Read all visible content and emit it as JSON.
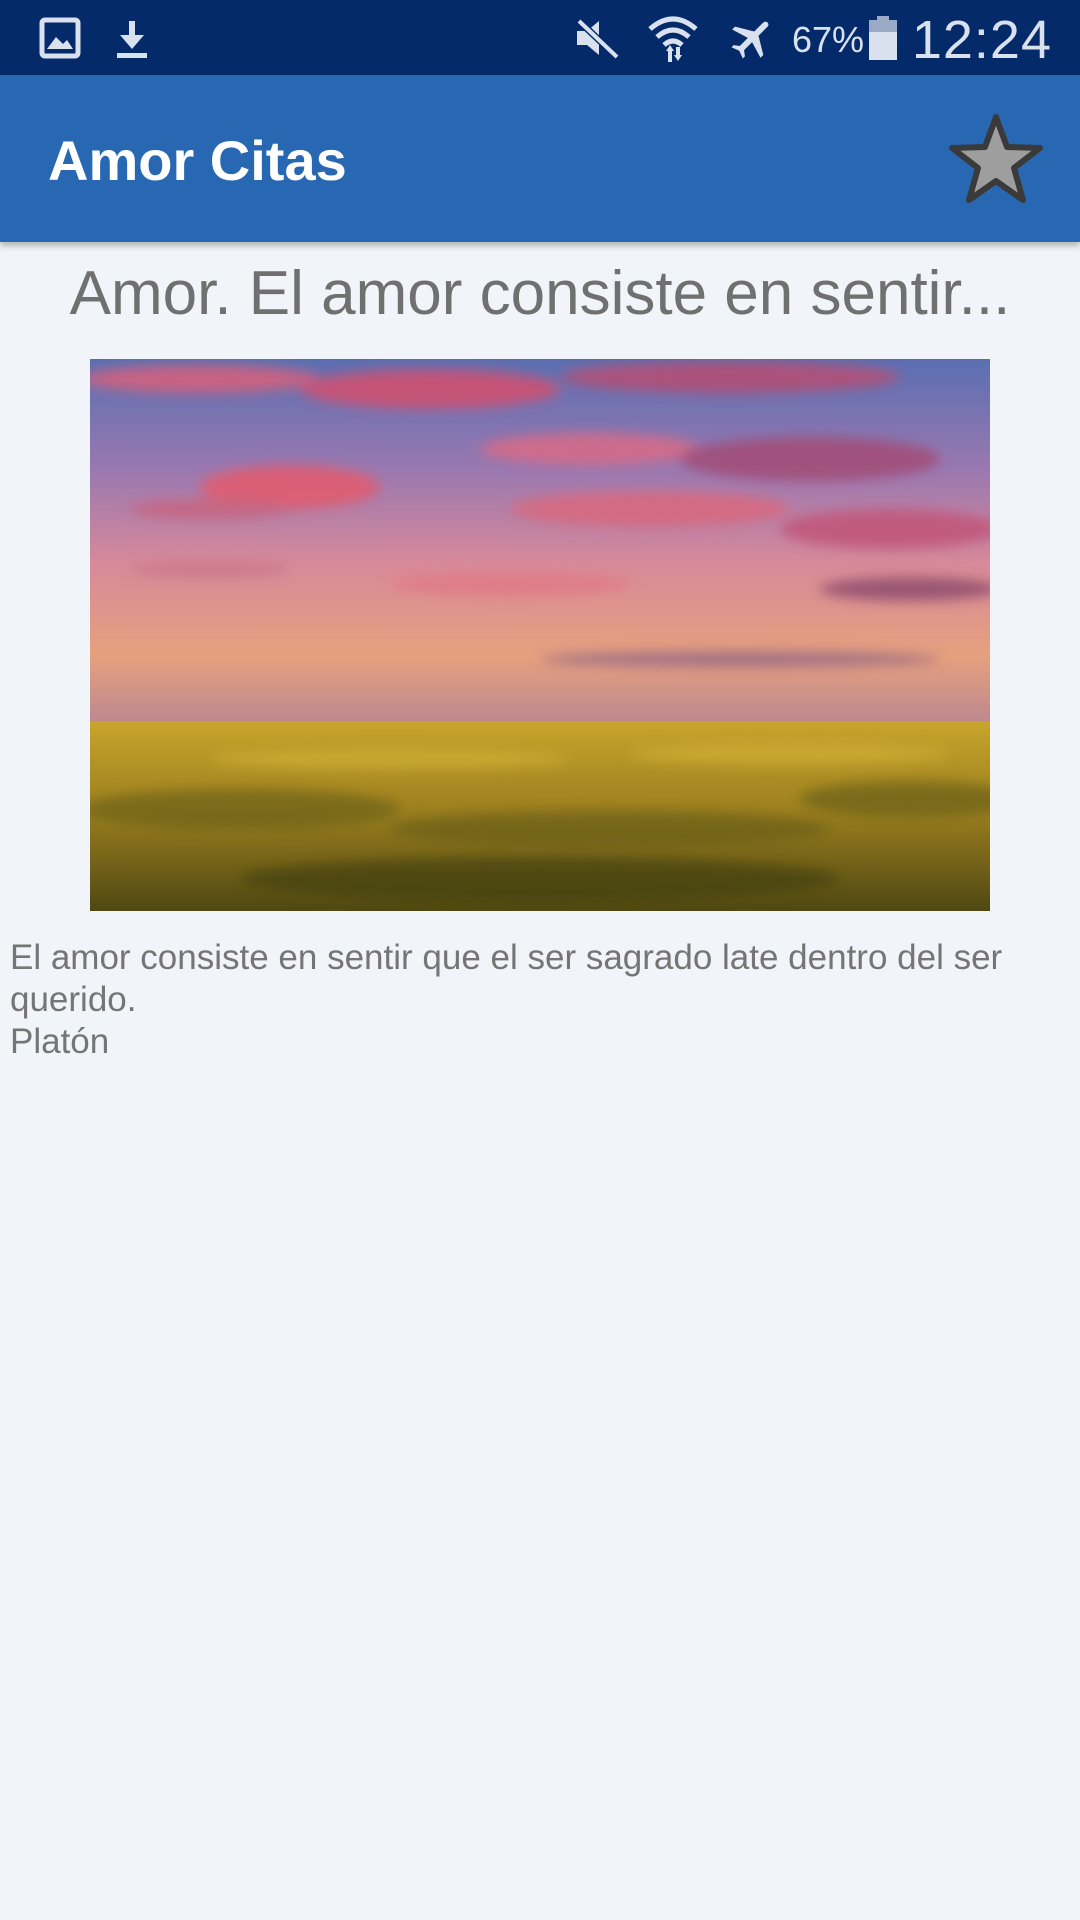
{
  "status_bar": {
    "battery_percent": "67%",
    "time": "12:24",
    "icons": [
      "image-notification-icon",
      "download-icon",
      "mute-icon",
      "wifi-icon",
      "airplane-mode-icon",
      "battery-icon"
    ]
  },
  "app_bar": {
    "title": "Amor Citas",
    "favorite_icon": "star-icon"
  },
  "quote": {
    "title": "Amor. El amor consiste en sentir...",
    "text": "El amor consiste en sentir que el ser sagrado late dentro del ser querido.",
    "author": "Platón",
    "image_description_icon": "sunset-field-image"
  },
  "colors": {
    "status_bar": "#042a6a",
    "app_bar": "#2868b3",
    "background": "#f1f4f8",
    "text": "#757575"
  }
}
